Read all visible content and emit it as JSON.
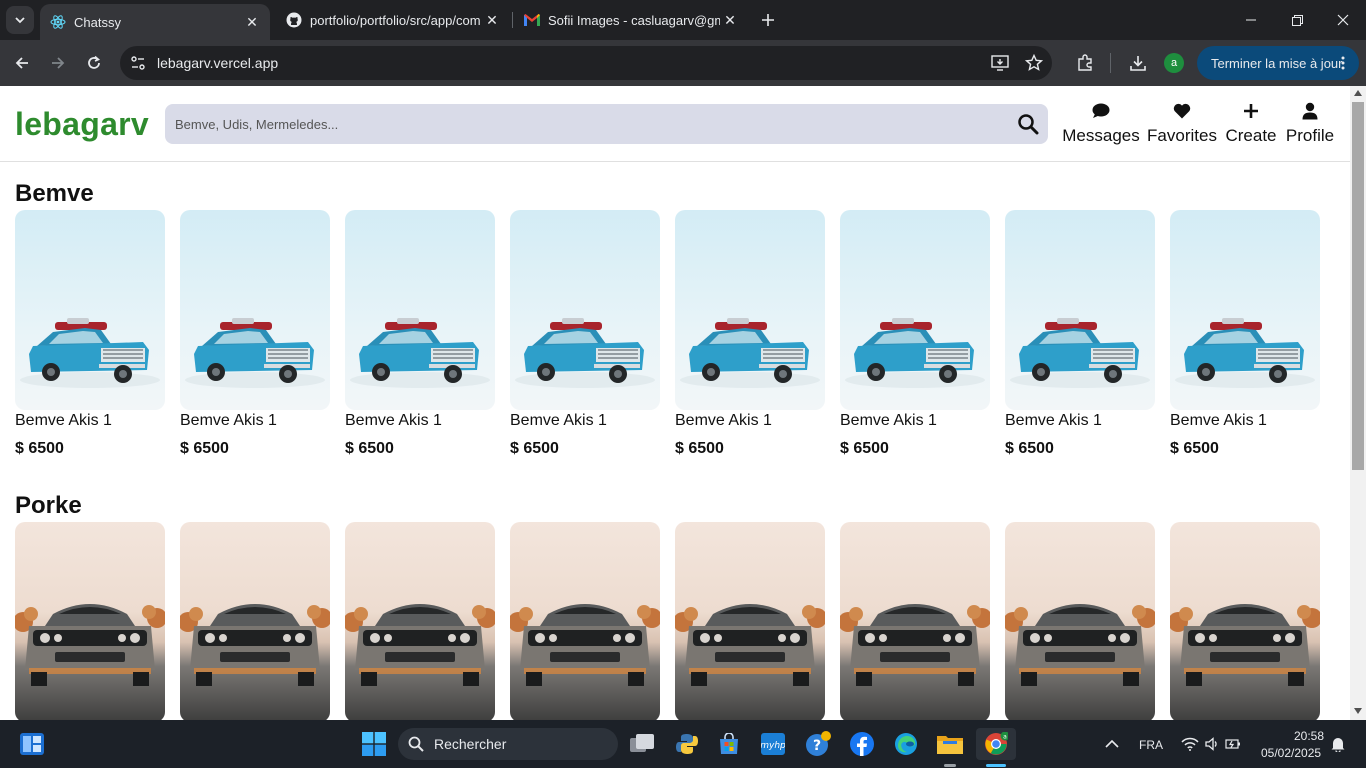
{
  "browser": {
    "tabs": [
      {
        "title": "Chatssy",
        "icon": "react-icon",
        "active": true
      },
      {
        "title": "portfolio/portfolio/src/app/com",
        "icon": "github-icon",
        "active": false
      },
      {
        "title": "Sofii Images - casluagarv@gma",
        "icon": "gmail-icon",
        "active": false
      }
    ],
    "url": "lebagarv.vercel.app",
    "update_button": "Terminer la mise à jour",
    "profile_letter": "a"
  },
  "site": {
    "logo": "lebagarv",
    "search_placeholder": "Bemve, Udis, Mermeledes...",
    "nav": [
      {
        "label": "Messages",
        "icon": "chat-bubble-icon"
      },
      {
        "label": "Favorites",
        "icon": "heart-icon"
      },
      {
        "label": "Create",
        "icon": "plus-icon"
      },
      {
        "label": "Profile",
        "icon": "user-icon"
      }
    ]
  },
  "sections": [
    {
      "title": "Bemve",
      "image": "blue-car-in-snow",
      "cards": [
        {
          "name": "Bemve Akis 1",
          "price": "$ 6500"
        },
        {
          "name": "Bemve Akis 1",
          "price": "$ 6500"
        },
        {
          "name": "Bemve Akis 1",
          "price": "$ 6500"
        },
        {
          "name": "Bemve Akis 1",
          "price": "$ 6500"
        },
        {
          "name": "Bemve Akis 1",
          "price": "$ 6500"
        },
        {
          "name": "Bemve Akis 1",
          "price": "$ 6500"
        },
        {
          "name": "Bemve Akis 1",
          "price": "$ 6500"
        },
        {
          "name": "Bemve Akis 1",
          "price": "$ 6500"
        }
      ]
    },
    {
      "title": "Porke",
      "image": "grey-muscle-car-front",
      "cards": [
        {
          "name": "",
          "price": ""
        },
        {
          "name": "",
          "price": ""
        },
        {
          "name": "",
          "price": ""
        },
        {
          "name": "",
          "price": ""
        },
        {
          "name": "",
          "price": ""
        },
        {
          "name": "",
          "price": ""
        },
        {
          "name": "",
          "price": ""
        },
        {
          "name": "",
          "price": ""
        }
      ]
    }
  ],
  "taskbar": {
    "search_label": "Rechercher",
    "language": "FRA",
    "time": "20:58",
    "date": "05/02/2025"
  }
}
